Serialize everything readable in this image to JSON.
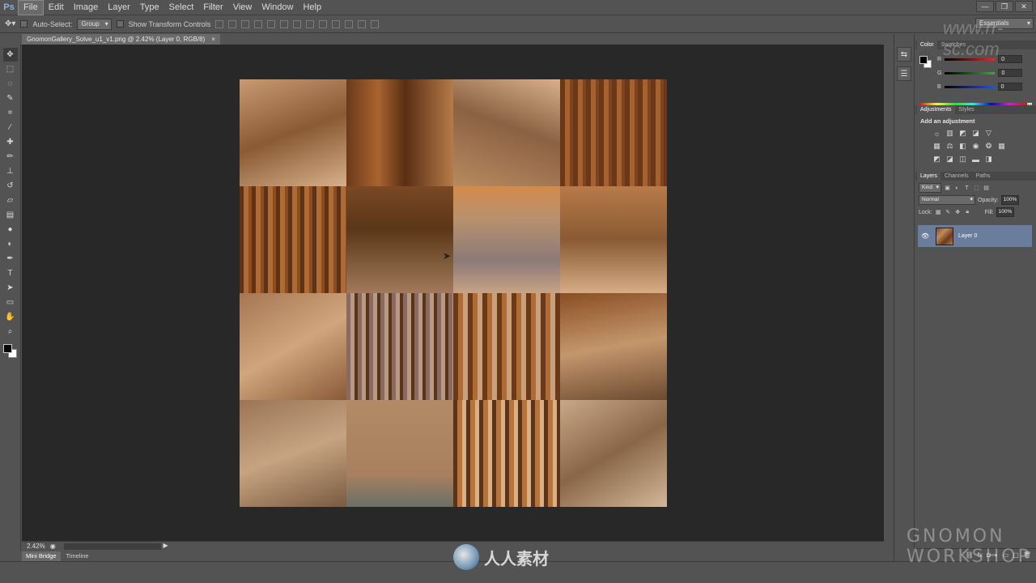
{
  "app": {
    "logo": "Ps",
    "menus": [
      "File",
      "Edit",
      "Image",
      "Layer",
      "Type",
      "Select",
      "Filter",
      "View",
      "Window",
      "Help"
    ],
    "window_controls": [
      "—",
      "❐",
      "✕"
    ]
  },
  "options_bar": {
    "auto_select_label": "Auto-Select:",
    "auto_select_value": "Group",
    "transform_label": "Show Transform Controls",
    "workspace": "Essentials"
  },
  "document": {
    "tab_title": "GnomonGallery_Solve_u1_v1.png @ 2.42% (Layer 0, RGB/8)",
    "tab_close": "×",
    "zoom": "2.42%"
  },
  "bottom_tabs": [
    "Mini Bridge",
    "Timeline"
  ],
  "color_panel": {
    "tabs": [
      "Color",
      "Swatches"
    ],
    "rows": [
      {
        "label": "R",
        "value": "0",
        "color": "#d83030"
      },
      {
        "label": "G",
        "value": "0",
        "color": "#30b030"
      },
      {
        "label": "B",
        "value": "0",
        "color": "#3050d8"
      }
    ]
  },
  "adjustments_panel": {
    "tabs": [
      "Adjustments",
      "Styles"
    ],
    "title": "Add an adjustment"
  },
  "layers_panel": {
    "tabs": [
      "Layers",
      "Channels",
      "Paths"
    ],
    "kind": "Kind",
    "blend_mode": "Normal",
    "opacity_label": "Opacity:",
    "opacity_value": "100%",
    "lock_label": "Lock:",
    "fill_label": "Fill:",
    "fill_value": "100%",
    "layer_name": "Layer 0"
  },
  "watermark": {
    "site_text": "人人素材",
    "brand_line1": "GNOMON",
    "brand_line2": "WORKSHOP",
    "corner_text": "www.rr-sc.com"
  },
  "colors": {
    "foreground": "#000000",
    "background": "#ffffff",
    "selected_layer": "#6a7d9c"
  }
}
